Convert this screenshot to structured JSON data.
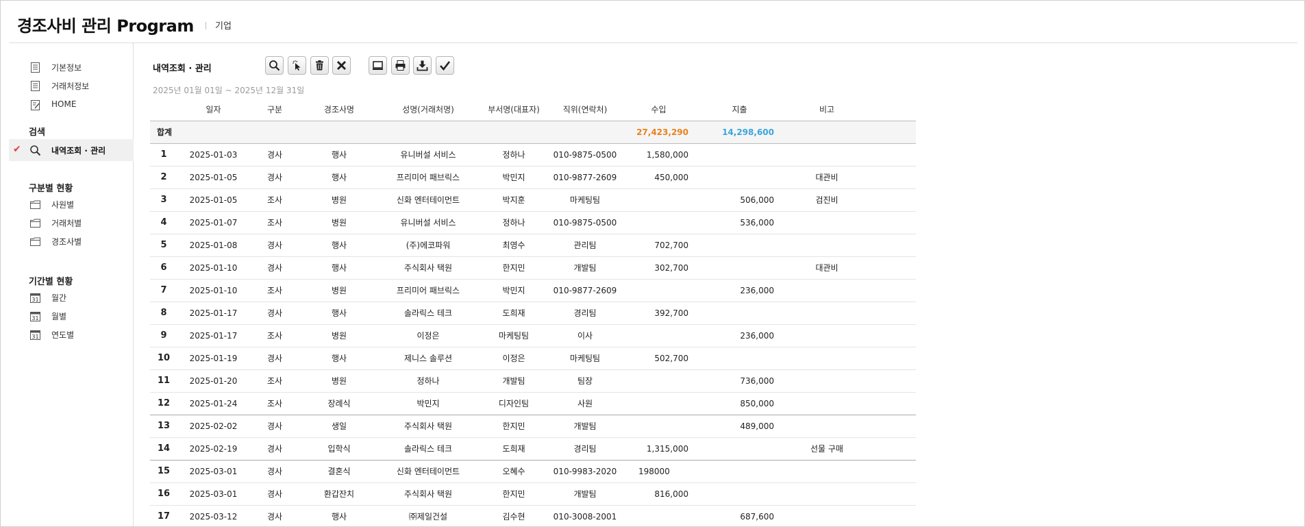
{
  "app": {
    "title": "경조사비 관리 Program",
    "subtitle": "기업"
  },
  "sidebar": {
    "top_items": [
      {
        "label": "기본정보",
        "icon": "document-icon"
      },
      {
        "label": "거래처정보",
        "icon": "document-icon"
      },
      {
        "label": "HOME",
        "icon": "edit-document-icon"
      }
    ],
    "search_section": {
      "title": "검색",
      "item": {
        "label": "내역조회 · 관리",
        "icon": "search-icon"
      }
    },
    "category_section": {
      "title": "구분별 현황",
      "items": [
        {
          "label": "사원별",
          "icon": "folder-icon"
        },
        {
          "label": "거래처별",
          "icon": "folder-icon"
        },
        {
          "label": "경조사별",
          "icon": "folder-icon"
        }
      ]
    },
    "period_section": {
      "title": "기간별 현황",
      "items": [
        {
          "label": "월간",
          "icon": "calendar-icon"
        },
        {
          "label": "월별",
          "icon": "calendar-icon"
        },
        {
          "label": "연도별",
          "icon": "calendar-icon"
        }
      ]
    }
  },
  "main": {
    "heading": "내역조회 · 관리",
    "period": "2025년 01월 01일 ~ 2025년 12월 31일",
    "toolbar": [
      "search-icon",
      "cursor-click-icon",
      "trash-icon",
      "close-icon",
      "monitor-icon",
      "print-icon",
      "download-icon",
      "check-icon"
    ],
    "columns": [
      "일자",
      "구분",
      "경조사명",
      "성명(거래처명)",
      "부서명(대표자)",
      "직위(연락처)",
      "수입",
      "지출",
      "비고"
    ],
    "total": {
      "label": "합계",
      "income": "27,423,290",
      "expense": "14,298,600"
    },
    "rows": [
      {
        "no": "1",
        "date": "2025-01-03",
        "type": "경사",
        "event": "행사",
        "name": "유니버설 서비스",
        "dept": "정하나",
        "pos": "010-9875-0500",
        "income": "1,580,000",
        "expense": "",
        "note": ""
      },
      {
        "no": "2",
        "date": "2025-01-05",
        "type": "경사",
        "event": "행사",
        "name": "프리미어 패브릭스",
        "dept": "박민지",
        "pos": "010-9877-2609",
        "income": "450,000",
        "expense": "",
        "note": "대관비"
      },
      {
        "no": "3",
        "date": "2025-01-05",
        "type": "조사",
        "event": "병원",
        "name": "신화 엔터테이먼트",
        "dept": "박지훈",
        "pos": "마케팅팀",
        "income": "",
        "expense": "506,000",
        "note": "검진비"
      },
      {
        "no": "4",
        "date": "2025-01-07",
        "type": "조사",
        "event": "병원",
        "name": "유니버설 서비스",
        "dept": "정하나",
        "pos": "010-9875-0500",
        "income": "",
        "expense": "536,000",
        "note": ""
      },
      {
        "no": "5",
        "date": "2025-01-08",
        "type": "경사",
        "event": "행사",
        "name": "(주)에코파워",
        "dept": "최영수",
        "pos": "관리팀",
        "income": "702,700",
        "expense": "",
        "note": ""
      },
      {
        "no": "6",
        "date": "2025-01-10",
        "type": "경사",
        "event": "행사",
        "name": "주식회사 택원",
        "dept": "한지민",
        "pos": "개발팀",
        "income": "302,700",
        "expense": "",
        "note": "대관비"
      },
      {
        "no": "7",
        "date": "2025-01-10",
        "type": "조사",
        "event": "병원",
        "name": "프리미어 패브릭스",
        "dept": "박민지",
        "pos": "010-9877-2609",
        "income": "",
        "expense": "236,000",
        "note": ""
      },
      {
        "no": "8",
        "date": "2025-01-17",
        "type": "경사",
        "event": "행사",
        "name": "솔라릭스 테크",
        "dept": "도희재",
        "pos": "경리팀",
        "income": "392,700",
        "expense": "",
        "note": ""
      },
      {
        "no": "9",
        "date": "2025-01-17",
        "type": "조사",
        "event": "병원",
        "name": "이정은",
        "dept": "마케팅팀",
        "pos": "이사",
        "income": "",
        "expense": "236,000",
        "note": ""
      },
      {
        "no": "10",
        "date": "2025-01-19",
        "type": "경사",
        "event": "행사",
        "name": "제니스 솔루션",
        "dept": "이정은",
        "pos": "마케팅팀",
        "income": "502,700",
        "expense": "",
        "note": ""
      },
      {
        "no": "11",
        "date": "2025-01-20",
        "type": "조사",
        "event": "병원",
        "name": "정하나",
        "dept": "개발팀",
        "pos": "팀장",
        "income": "",
        "expense": "736,000",
        "note": ""
      },
      {
        "no": "12",
        "date": "2025-01-24",
        "type": "조사",
        "event": "장례식",
        "name": "박민지",
        "dept": "디자인팀",
        "pos": "사원",
        "income": "",
        "expense": "850,000",
        "note": ""
      },
      {
        "no": "13",
        "date": "2025-02-02",
        "type": "경사",
        "event": "생일",
        "name": "주식회사 택원",
        "dept": "한지민",
        "pos": "개발팀",
        "income": "",
        "expense": "489,000",
        "note": ""
      },
      {
        "no": "14",
        "date": "2025-02-19",
        "type": "경사",
        "event": "입학식",
        "name": "솔라릭스 테크",
        "dept": "도희재",
        "pos": "경리팀",
        "income": "1,315,000",
        "expense": "",
        "note": "선물 구매"
      },
      {
        "no": "15",
        "date": "2025-03-01",
        "type": "경사",
        "event": "결혼식",
        "name": "신화 엔터테이먼트",
        "dept": "오혜수",
        "pos": "010-9983-2020",
        "income": "198000",
        "expense": "",
        "note": ""
      },
      {
        "no": "16",
        "date": "2025-03-01",
        "type": "경사",
        "event": "환갑잔치",
        "name": "주식회사 택원",
        "dept": "한지민",
        "pos": "개발팀",
        "income": "816,000",
        "expense": "",
        "note": ""
      },
      {
        "no": "17",
        "date": "2025-03-12",
        "type": "경사",
        "event": "행사",
        "name": "㈜제일건설",
        "dept": "김수현",
        "pos": "010-3008-2001",
        "income": "",
        "expense": "687,600",
        "note": ""
      }
    ]
  }
}
